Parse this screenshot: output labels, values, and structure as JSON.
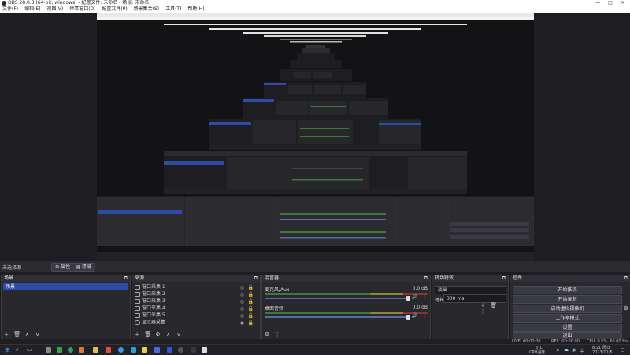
{
  "window": {
    "title": "OBS 28.0.3 (64-bit, windows) - 配置文件: 未命名 - 场景: 未命名",
    "min": "—",
    "max": "□",
    "close": "✕"
  },
  "menu": [
    "文件(F)",
    "编辑(E)",
    "视图(V)",
    "停靠窗口(D)",
    "配置文件(P)",
    "场景集合(S)",
    "工具(T)",
    "帮助(H)"
  ],
  "belt": {
    "label": "未选择源",
    "props": "属性",
    "filters": "滤镜"
  },
  "scenes": {
    "title": "场景",
    "items": [
      "场景"
    ],
    "add": "+",
    "remove": "🗑",
    "up": "∧",
    "down": "∨"
  },
  "sources": {
    "title": "来源",
    "items": [
      "窗口采集 1",
      "窗口采集 2",
      "窗口采集 3",
      "窗口采集 4",
      "窗口采集 5",
      "显示器采集"
    ]
  },
  "mixer": {
    "title": "混音器",
    "channels": [
      {
        "name": "麦克风/Aux",
        "db": "0.0 dB"
      },
      {
        "name": "桌面音频",
        "db": "0.0 dB"
      }
    ]
  },
  "transitions": {
    "title": "转场特效",
    "type": "淡出",
    "duration_label": "时长",
    "duration": "300 ms"
  },
  "controls": {
    "title": "控件",
    "buttons": [
      "开始推流",
      "开始录制",
      "启动虚拟摄像机",
      "工作室模式",
      "设置",
      "退出"
    ]
  },
  "status": {
    "live": "LIVE: 00:00:00",
    "rec": "REC: 00:00:00",
    "cpu": "CPU: 0.5%, 60.00 fps"
  },
  "tray": {
    "weather": "5°C",
    "weather2": "CPU温度",
    "time": "8:21 周日",
    "date": "2023/11/5"
  },
  "colors": {
    "accent": "#2d4ba8",
    "panel": "#28282d",
    "bg": "#1e1e22"
  }
}
